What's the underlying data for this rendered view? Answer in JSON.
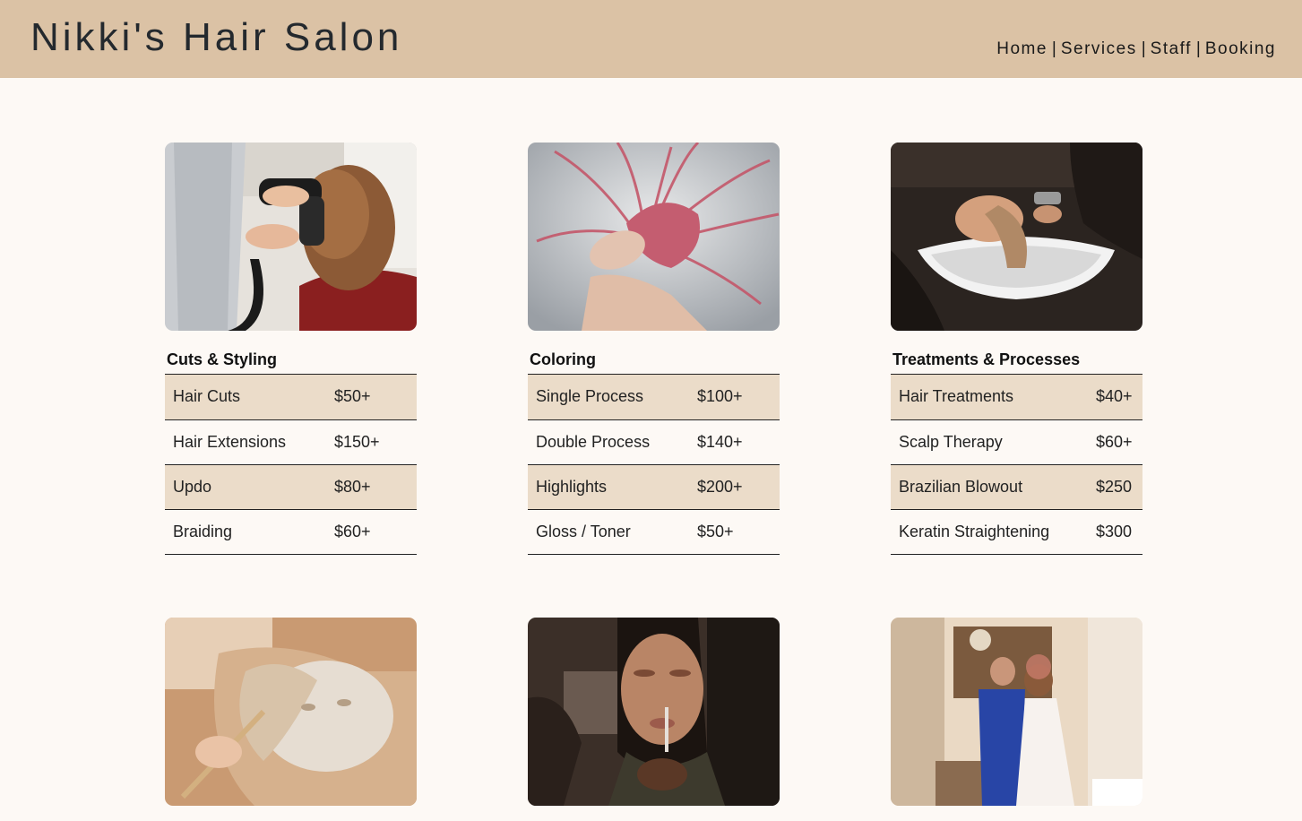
{
  "header": {
    "title": "Nikki's Hair Salon",
    "nav": [
      {
        "label": "Home"
      },
      {
        "label": "Services"
      },
      {
        "label": "Staff"
      },
      {
        "label": "Booking"
      }
    ],
    "separator": "|"
  },
  "categories": [
    {
      "title": "Cuts & Styling",
      "image": "blow-dry-styling-photo",
      "services": [
        {
          "name": "Hair Cuts",
          "price": "$50+"
        },
        {
          "name": "Hair Extensions",
          "price": "$150+"
        },
        {
          "name": "Updo",
          "price": "$80+"
        },
        {
          "name": "Braiding",
          "price": "$60+"
        }
      ]
    },
    {
      "title": "Coloring",
      "image": "pink-hair-photo",
      "services": [
        {
          "name": "Single Process",
          "price": "$100+"
        },
        {
          "name": "Double Process",
          "price": "$140+"
        },
        {
          "name": "Highlights",
          "price": "$200+"
        },
        {
          "name": "Gloss / Toner",
          "price": "$50+"
        }
      ]
    },
    {
      "title": "Treatments & Processes",
      "image": "hair-wash-photo",
      "services": [
        {
          "name": "Hair Treatments",
          "price": "$40+"
        },
        {
          "name": "Scalp Therapy",
          "price": "$60+"
        },
        {
          "name": "Brazilian Blowout",
          "price": "$250"
        },
        {
          "name": "Keratin Straightening",
          "price": "$300"
        }
      ]
    }
  ],
  "lower_images": [
    "facial-mask-photo",
    "makeup-photo",
    "wedding-couple-photo"
  ],
  "colors": {
    "header_bg": "#dbc2a5",
    "page_bg": "#fdf9f5",
    "row_stripe": "#ebdcc9"
  }
}
